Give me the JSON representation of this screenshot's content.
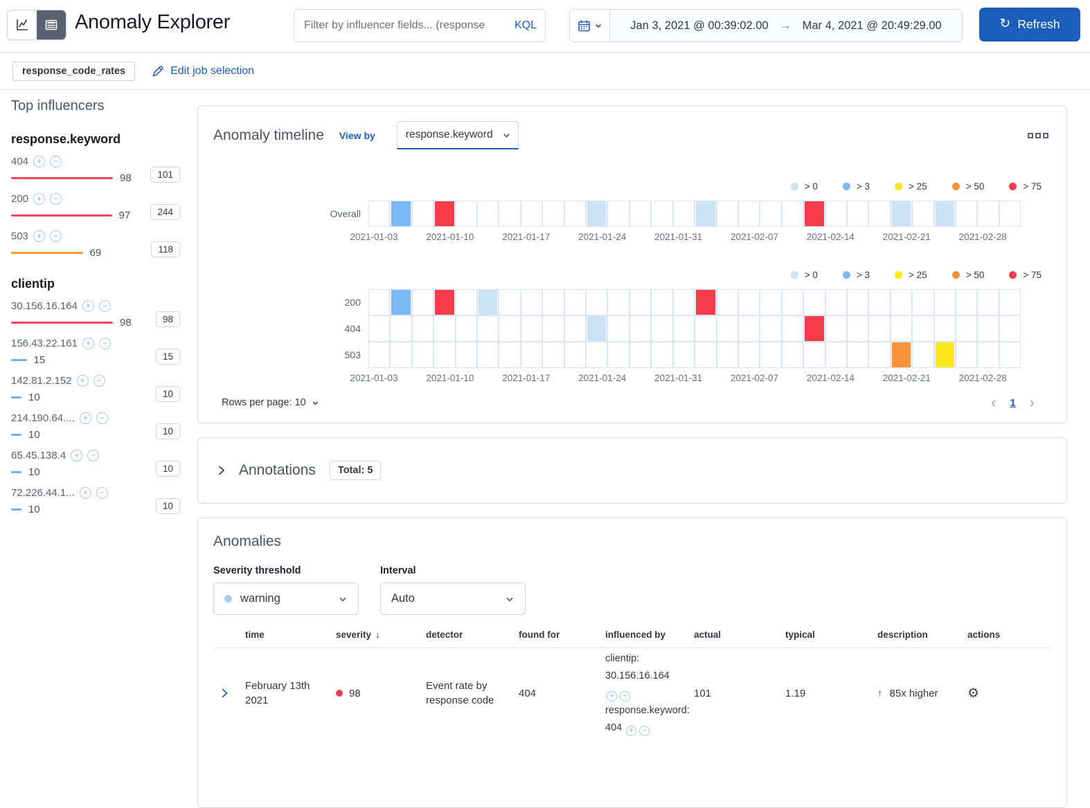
{
  "colors": {
    "accent": "#1a5eb9",
    "low": "#c9e2f6",
    "warning": "#7ab8f7",
    "minor": "#fbe920",
    "major": "#f7943b",
    "critical": "#f73d4b"
  },
  "header": {
    "title": "Anomaly Explorer",
    "filter_placeholder": "Filter by influencer fields... (response",
    "kql_label": "KQL",
    "date_start": "Jan 3, 2021 @ 00:39:02.00",
    "date_end": "Mar 4, 2021 @ 20:49:29.00",
    "refresh_label": "Refresh"
  },
  "job_bar": {
    "job_badge": "response_code_rates",
    "edit_link": "Edit job selection"
  },
  "influencers": {
    "title": "Top influencers",
    "groups": [
      {
        "field": "response.keyword",
        "items": [
          {
            "label": "404",
            "score": 98,
            "badge": "101",
            "bar_color": "#f5475a"
          },
          {
            "label": "200",
            "score": 97,
            "badge": "244",
            "bar_color": "#f5475a"
          },
          {
            "label": "503",
            "score": 69,
            "badge": "118",
            "bar_color": "#f79a28"
          }
        ]
      },
      {
        "field": "clientip",
        "items": [
          {
            "label": "30.156.16.164",
            "score": 98,
            "badge": "98",
            "bar_color": "#f5475a"
          },
          {
            "label": "156.43.22.161",
            "score": 15,
            "badge": "15",
            "bar_color": "#74b0e6"
          },
          {
            "label": "142.81.2.152",
            "score": 10,
            "badge": "10",
            "bar_color": "#74b0e6"
          },
          {
            "label": "214.190.64....",
            "score": 10,
            "badge": "10",
            "bar_color": "#74b0e6"
          },
          {
            "label": "65.45.138.4",
            "score": 10,
            "badge": "10",
            "bar_color": "#74b0e6"
          },
          {
            "label": "72.226.44.1...",
            "score": 10,
            "badge": "10",
            "bar_color": "#74b0e6"
          }
        ]
      }
    ]
  },
  "timeline": {
    "title": "Anomaly timeline",
    "view_by_label": "View by",
    "view_by_value": "response.keyword",
    "legend": [
      {
        "label": "> 0",
        "severity": "low"
      },
      {
        "label": "> 3",
        "severity": "warning"
      },
      {
        "label": "> 25",
        "severity": "minor"
      },
      {
        "label": "> 50",
        "severity": "major"
      },
      {
        "label": "> 75",
        "severity": "critical"
      }
    ],
    "num_cells": 30,
    "axis_labels": [
      "2021-01-03",
      "2021-01-10",
      "2021-01-17",
      "2021-01-24",
      "2021-01-31",
      "2021-02-07",
      "2021-02-14",
      "2021-02-21",
      "2021-02-28"
    ],
    "overall_lane": {
      "label": "Overall",
      "cells": [
        {
          "index": 1,
          "severity": "warning"
        },
        {
          "index": 3,
          "severity": "critical"
        },
        {
          "index": 10,
          "severity": "low"
        },
        {
          "index": 15,
          "severity": "low"
        },
        {
          "index": 20,
          "severity": "critical"
        },
        {
          "index": 24,
          "severity": "low"
        },
        {
          "index": 26,
          "severity": "low"
        }
      ]
    },
    "view_by_lanes": [
      {
        "label": "200",
        "cells": [
          {
            "index": 1,
            "severity": "warning"
          },
          {
            "index": 3,
            "severity": "critical"
          },
          {
            "index": 5,
            "severity": "low"
          },
          {
            "index": 15,
            "severity": "critical"
          }
        ]
      },
      {
        "label": "404",
        "cells": [
          {
            "index": 10,
            "severity": "low"
          },
          {
            "index": 20,
            "severity": "critical"
          }
        ]
      },
      {
        "label": "503",
        "cells": [
          {
            "index": 24,
            "severity": "major"
          },
          {
            "index": 26,
            "severity": "minor"
          }
        ]
      }
    ],
    "footer": {
      "rows_per_page": "Rows per page: 10",
      "page": "1"
    }
  },
  "annotations": {
    "title": "Annotations",
    "badge": "Total: 5"
  },
  "anomalies": {
    "title": "Anomalies",
    "severity": {
      "label": "Severity threshold",
      "value": "warning"
    },
    "interval": {
      "label": "Interval",
      "value": "Auto"
    },
    "table": {
      "columns": [
        {
          "label": "time"
        },
        {
          "label": "severity",
          "sorted": true
        },
        {
          "label": "detector"
        },
        {
          "label": "found for"
        },
        {
          "label": "influenced by"
        },
        {
          "label": "actual"
        },
        {
          "label": "typical"
        },
        {
          "label": "description"
        },
        {
          "label": "actions"
        }
      ],
      "rows": [
        {
          "time": "February 13th 2021",
          "severity_score": "98",
          "severity": "critical",
          "detector": "Event rate by response code",
          "found_for": "404",
          "influenced_by": [
            "clientip: 30.156.16.164",
            "response.keyword: 404"
          ],
          "actual": "101",
          "typical": "1.19",
          "description": "85x higher",
          "description_direction": "up"
        }
      ]
    }
  }
}
